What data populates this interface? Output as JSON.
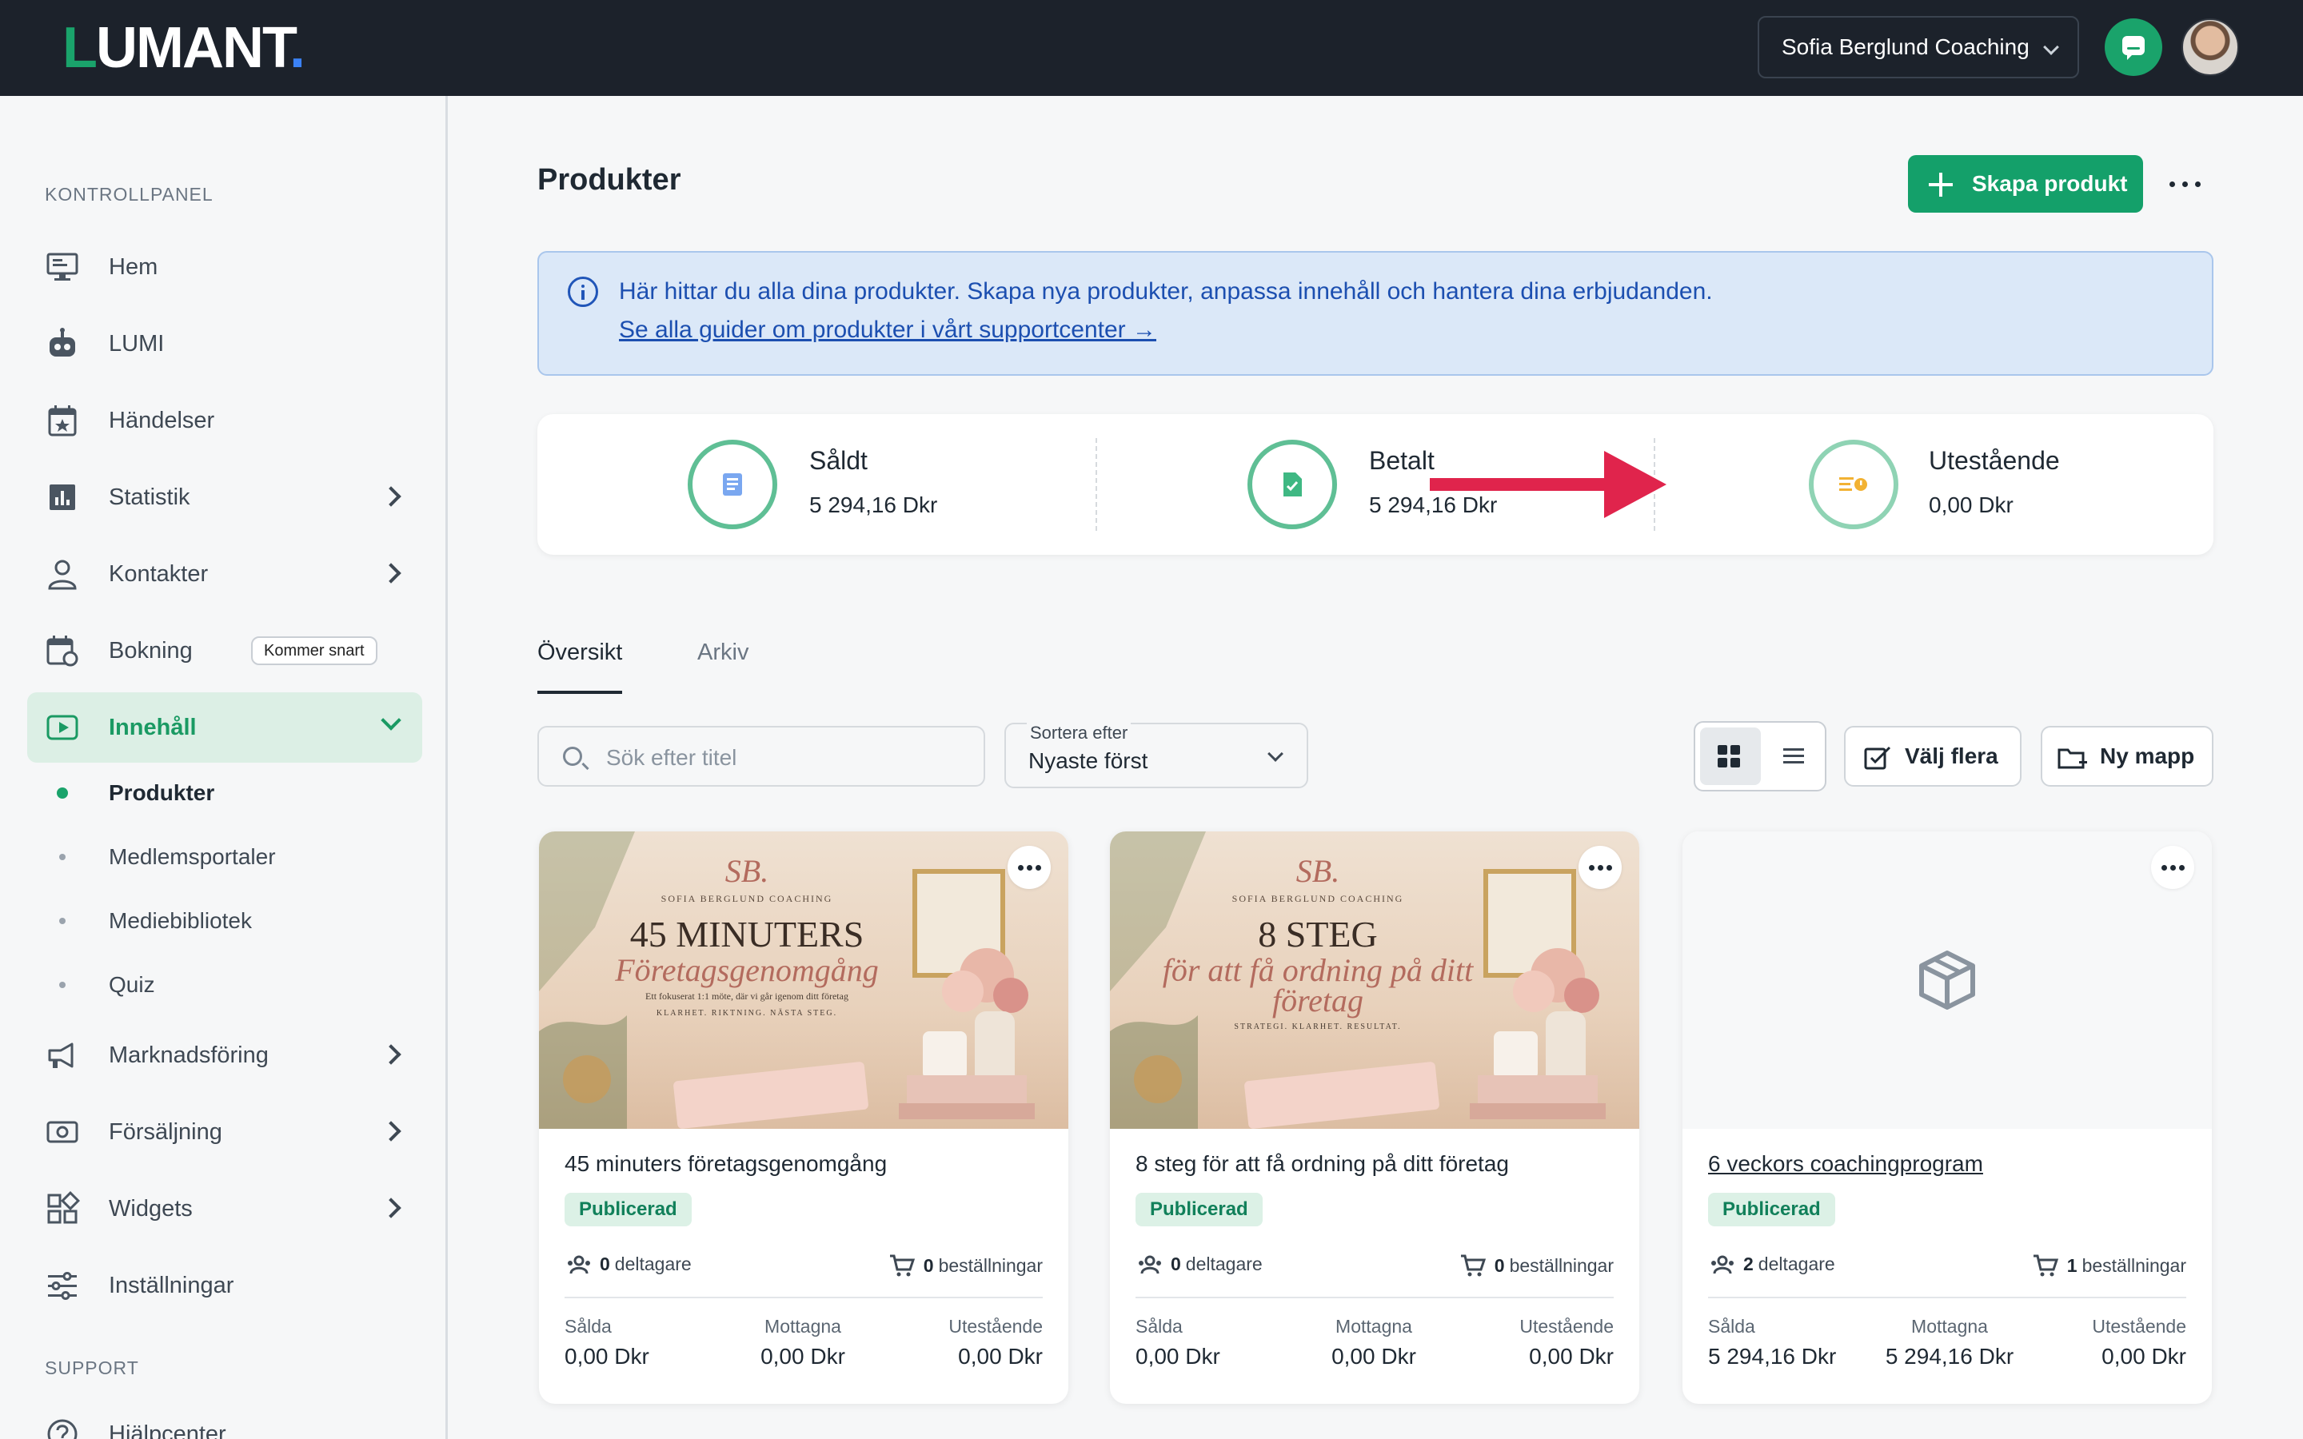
{
  "app": {
    "logo": {
      "first": "L",
      "rest": "UMANT",
      "dot": "."
    },
    "account": "Sofia Berglund Coaching"
  },
  "colors": {
    "brand": "#14a06a",
    "topbar": "#1c222b",
    "info_bg": "#dbe8f8",
    "info_text": "#1c4fb0",
    "arrow": "#e0244c"
  },
  "sidebar": {
    "section_main": "KONTROLLPANEL",
    "section_support": "SUPPORT",
    "items": [
      {
        "label": "Hem",
        "icon": "monitor-icon"
      },
      {
        "label": "LUMI",
        "icon": "robot-icon"
      },
      {
        "label": "Händelser",
        "icon": "calendar-star-icon"
      },
      {
        "label": "Statistik",
        "icon": "bar-chart-icon"
      },
      {
        "label": "Kontakter",
        "icon": "person-icon"
      },
      {
        "label": "Bokning",
        "icon": "calendar-sync-icon",
        "badge": "Kommer snart"
      },
      {
        "label": "Innehåll",
        "icon": "play-square-icon"
      },
      {
        "label": "Marknadsföring",
        "icon": "megaphone-icon"
      },
      {
        "label": "Försäljning",
        "icon": "cash-icon"
      },
      {
        "label": "Widgets",
        "icon": "widgets-icon"
      },
      {
        "label": "Inställningar",
        "icon": "sliders-icon"
      },
      {
        "label": "Hjälpcenter",
        "icon": "help-icon"
      }
    ],
    "sub_items": [
      "Produkter",
      "Medlemsportaler",
      "Mediebibliotek",
      "Quiz"
    ]
  },
  "main": {
    "title": "Produkter",
    "create_button": "Skapa produkt",
    "info": {
      "text": "Här hittar du alla dina produkter. Skapa nya produkter, anpassa innehåll och hantera dina erbjudanden.",
      "link": "Se alla guider om produkter i vårt supportcenter →"
    },
    "stats": [
      {
        "label": "Såldt",
        "value": "5 294,16 Dkr",
        "icon": "receipt-icon"
      },
      {
        "label": "Betalt",
        "value": "5 294,16 Dkr",
        "icon": "paid-document-icon"
      },
      {
        "label": "Utestående",
        "value": "0,00 Dkr",
        "icon": "pending-icon"
      }
    ],
    "tabs": [
      "Översikt",
      "Arkiv"
    ],
    "search_placeholder": "Sök efter titel",
    "sort": {
      "caption": "Sortera efter",
      "value": "Nyaste först"
    },
    "select_many": "Välj flera",
    "new_folder": "Ny mapp",
    "products": [
      {
        "title": "45 minuters företagsgenomgång",
        "status": "Publicerad",
        "participants": "0",
        "participants_label": "deltagare",
        "orders": "0",
        "orders_label": "beställningar",
        "sold_label": "Sålda",
        "sold": "0,00 Dkr",
        "received_label": "Mottagna",
        "received": "0,00 Dkr",
        "outstanding_label": "Utestående",
        "outstanding": "0,00 Dkr",
        "poster": {
          "mono": "SB.",
          "brand": "SOFIA BERGLUND COACHING",
          "big": "45 MINUTERS",
          "script": "Företagsgenomgång",
          "small": "Ett fokuserat 1:1 möte, där vi går igenom ditt företag",
          "tag": "KLARHET. RIKTNING. NÄSTA STEG."
        }
      },
      {
        "title": "8 steg för att få ordning på ditt företag",
        "status": "Publicerad",
        "participants": "0",
        "participants_label": "deltagare",
        "orders": "0",
        "orders_label": "beställningar",
        "sold_label": "Sålda",
        "sold": "0,00 Dkr",
        "received_label": "Mottagna",
        "received": "0,00 Dkr",
        "outstanding_label": "Utestående",
        "outstanding": "0,00 Dkr",
        "poster": {
          "mono": "SB.",
          "brand": "SOFIA BERGLUND COACHING",
          "big": "8 STEG",
          "script": "för att få ordning på ditt företag",
          "small": "",
          "tag": "STRATEGI. KLARHET. RESULTAT."
        }
      },
      {
        "title": "6 veckors coachingprogram",
        "status": "Publicerad",
        "participants": "2",
        "participants_label": "deltagare",
        "orders": "1",
        "orders_label": "beställningar",
        "sold_label": "Sålda",
        "sold": "5 294,16 Dkr",
        "received_label": "Mottagna",
        "received": "5 294,16 Dkr",
        "outstanding_label": "Utestående",
        "outstanding": "0,00 Dkr"
      }
    ]
  }
}
